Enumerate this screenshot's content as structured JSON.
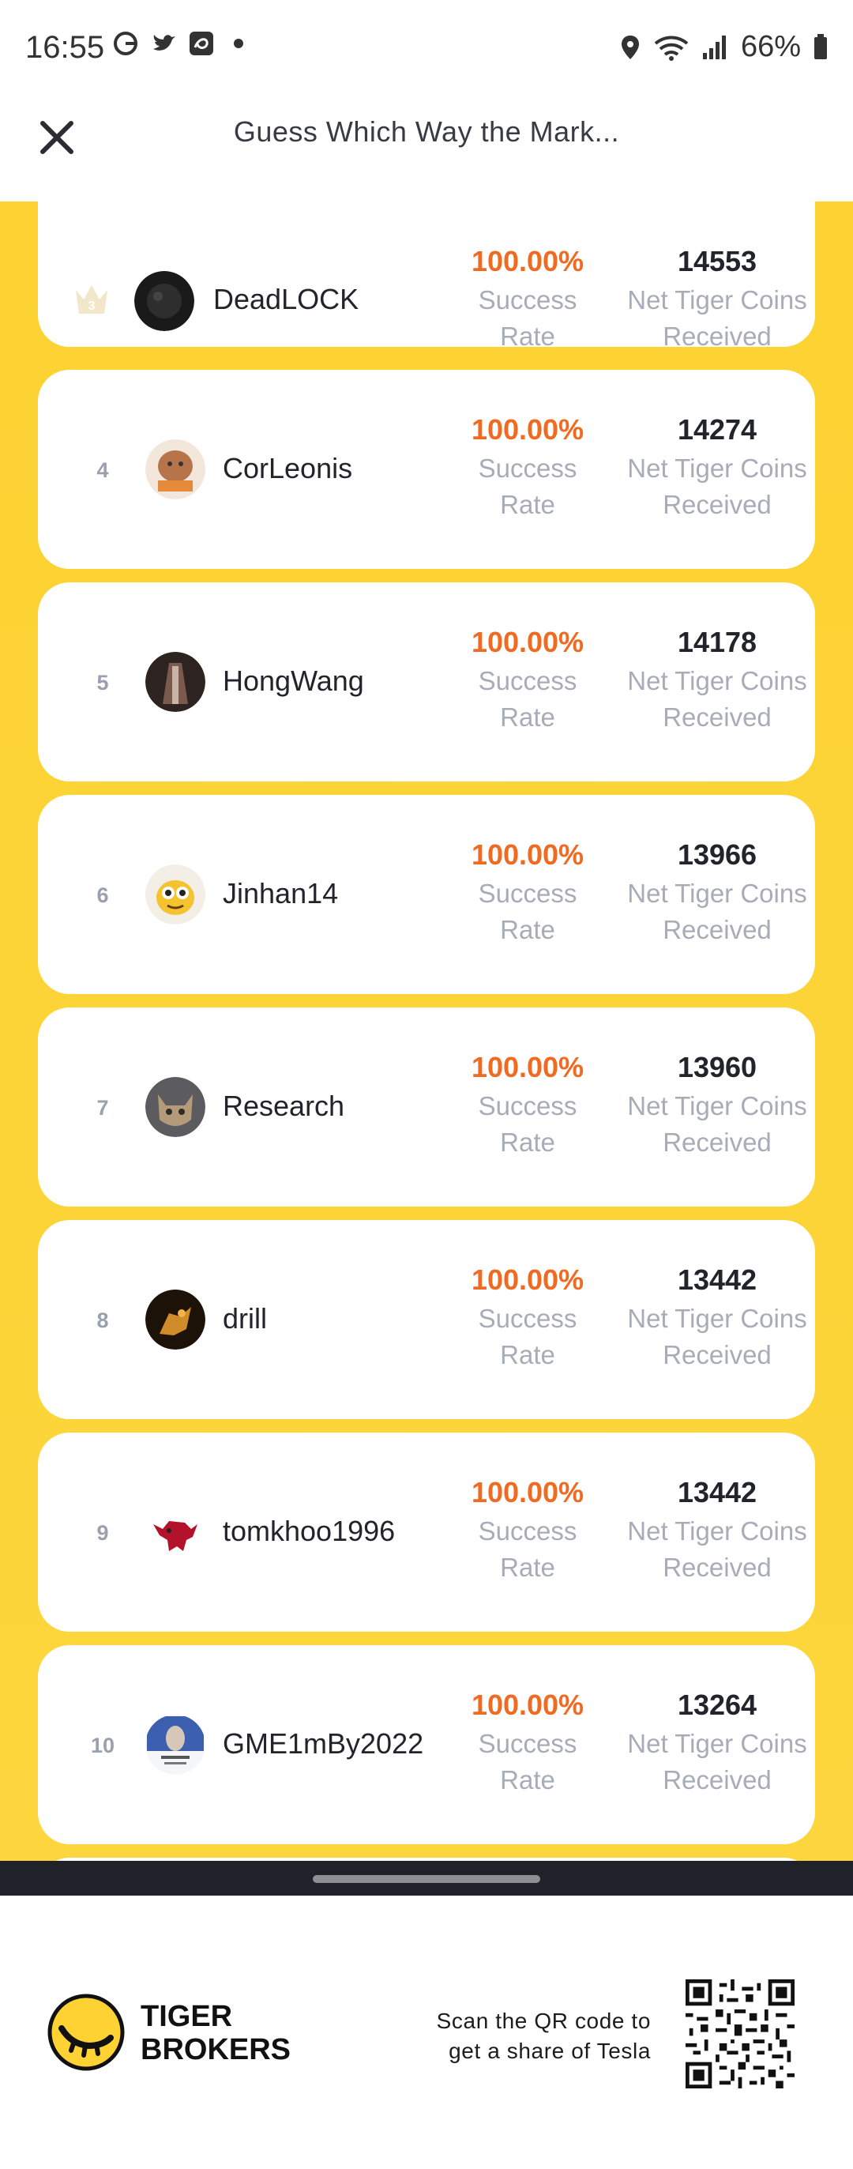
{
  "status_bar": {
    "time": "16:55",
    "battery": "66%",
    "icons": [
      "google-icon",
      "twitter-icon",
      "disney-plus-icon",
      "notification-dot-icon",
      "location-icon",
      "wifi-icon",
      "signal-icon",
      "battery-icon"
    ]
  },
  "header": {
    "title": "Guess Which Way the Mark...",
    "close_icon": "close-icon"
  },
  "labels": {
    "success_rate": "Success\nRate",
    "net_coins": "Net Tiger Coins\nReceived"
  },
  "leaderboard": [
    {
      "rank": "3",
      "name": "DeadLOCK",
      "rate": "100.00%",
      "rate_label_1": "Success",
      "rate_label_2": "Rate",
      "coins": "14553",
      "coins_label_1": "Net Tiger Coins",
      "coins_label_2": "Received",
      "badge": "crown-icon"
    },
    {
      "rank": "4",
      "name": "CorLeonis",
      "rate": "100.00%",
      "rate_label_1": "Success",
      "rate_label_2": "Rate",
      "coins": "14274",
      "coins_label_1": "Net Tiger Coins",
      "coins_label_2": "Received"
    },
    {
      "rank": "5",
      "name": "HongWang",
      "rate": "100.00%",
      "rate_label_1": "Success",
      "rate_label_2": "Rate",
      "coins": "14178",
      "coins_label_1": "Net Tiger Coins",
      "coins_label_2": "Received"
    },
    {
      "rank": "6",
      "name": "Jinhan14",
      "rate": "100.00%",
      "rate_label_1": "Success",
      "rate_label_2": "Rate",
      "coins": "13966",
      "coins_label_1": "Net Tiger Coins",
      "coins_label_2": "Received"
    },
    {
      "rank": "7",
      "name": "Research",
      "rate": "100.00%",
      "rate_label_1": "Success",
      "rate_label_2": "Rate",
      "coins": "13960",
      "coins_label_1": "Net Tiger Coins",
      "coins_label_2": "Received"
    },
    {
      "rank": "8",
      "name": "drill",
      "rate": "100.00%",
      "rate_label_1": "Success",
      "rate_label_2": "Rate",
      "coins": "13442",
      "coins_label_1": "Net Tiger Coins",
      "coins_label_2": "Received"
    },
    {
      "rank": "9",
      "name": "tomkhoo1996",
      "rate": "100.00%",
      "rate_label_1": "Success",
      "rate_label_2": "Rate",
      "coins": "13442",
      "coins_label_1": "Net Tiger Coins",
      "coins_label_2": "Received"
    },
    {
      "rank": "10",
      "name": "GME1mBy2022",
      "rate": "100.00%",
      "rate_label_1": "Success",
      "rate_label_2": "Rate",
      "coins": "13264",
      "coins_label_1": "Net Tiger Coins",
      "coins_label_2": "Received"
    }
  ],
  "footer": {
    "brand_line1": "TIGER",
    "brand_line2": "BROKERS",
    "scan_line1": "Scan the QR code to",
    "scan_line2": "get a share of Tesla"
  },
  "colors": {
    "accent_yellow": "#fdd232",
    "rate_orange": "#f06a22",
    "label_gray": "#a8acb6"
  }
}
